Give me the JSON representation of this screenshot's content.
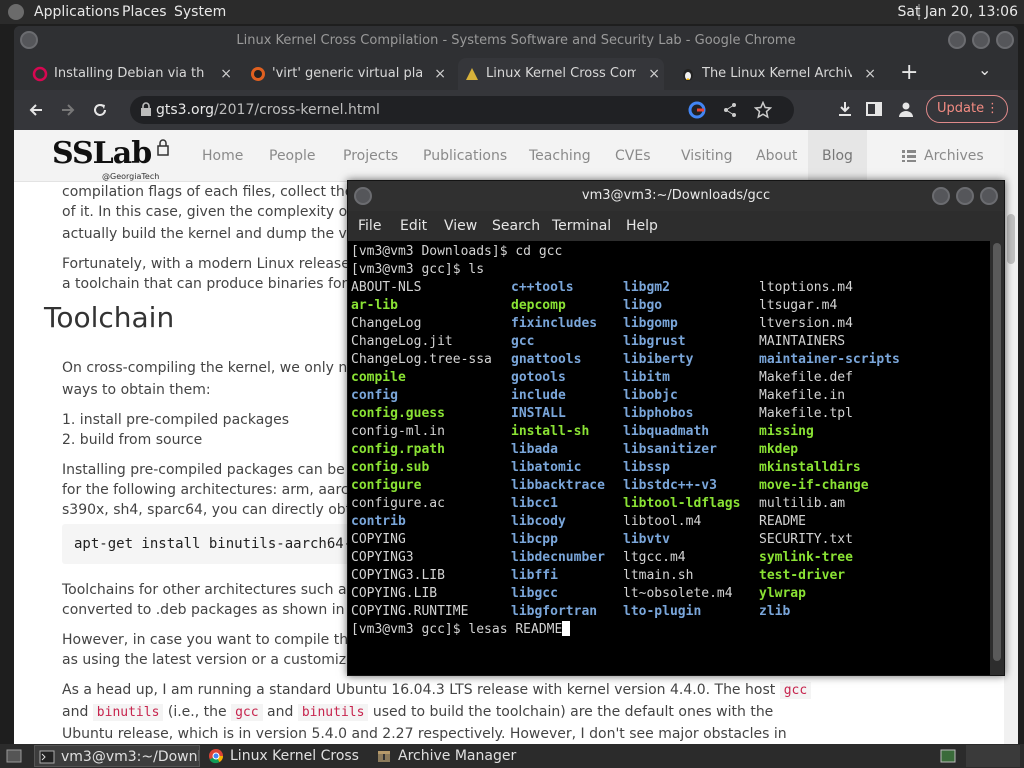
{
  "top_panel": {
    "menus": [
      "Applications",
      "Places",
      "System"
    ],
    "clock": "Sat Jan 20, 13:06"
  },
  "chrome": {
    "window_title": "Linux Kernel Cross Compilation - Systems Software and Security Lab - Google Chrome",
    "tabs": [
      {
        "label": "Installing Debian via the In",
        "close": "×"
      },
      {
        "label": "'virt' generic virtual platfo",
        "close": "×"
      },
      {
        "label": "Linux Kernel Cross Compi",
        "close": "×"
      },
      {
        "label": "The Linux Kernel Archives",
        "close": "×"
      }
    ],
    "new_tab": "+",
    "tab_menu": "⌄",
    "url_domain": "gts3.org",
    "url_path": "/2017/cross-kernel.html",
    "update_label": "Update"
  },
  "site": {
    "logo": "SSLab",
    "logo_sub": "@GeorgiaTech",
    "nav": [
      "Home",
      "People",
      "Projects",
      "Publications",
      "Teaching",
      "CVEs",
      "Visiting",
      "About",
      "Blog",
      "Archives"
    ]
  },
  "article": {
    "p1a": "compilation flags of each files, collect their link",
    "p1b": "of it. In this case, given the complexity of parsi",
    "p1c": "actually build the kernel and dump the verbose",
    "p2a": "Fortunately, with a modern Linux release (like",
    "p2b": "a toolchain that can produce binaries for anoth",
    "heading": "Toolchain",
    "p3a": "On cross-compiling the kernel, we only need t",
    "p3b": "ways to obtain them:",
    "li1": "1. install pre-compiled packages",
    "li2": "2. build from source",
    "p4a": "Installing pre-compiled packages can be a has",
    "p4b": "for the following architectures: arm, aarch64, h",
    "p4c": "s390x, sh4, sparc64, you can directly obtain t",
    "code1": "apt-get install binutils-aarch64-li",
    "p5a": "Toolchains for other architectures such as blac",
    "p5b": "converted to .deb packages as shown in the tu",
    "p6a": "However, in case you want to compile the tool",
    "p6b": "as using the latest version or a customized ve",
    "p7a": "As a head up, I am running a standard Ubuntu 16.04.3 LTS release with kernel version 4.4.0. The host",
    "p7a_code": "gcc",
    "p7b1": "and",
    "p7b_code1": "binutils",
    "p7b2": "(i.e., the",
    "p7b_code2": "gcc",
    "p7b3": "and",
    "p7b_code3": "binutils",
    "p7b4": "used to build the toolchain) are the default ones with the",
    "p7c": "Ubuntu release, which is in version 5.4.0 and 2.27 respectively. However, I don't see major obstacles in"
  },
  "terminal": {
    "title": "vm3@vm3:~/Downloads/gcc",
    "menu": [
      "File",
      "Edit",
      "View",
      "Search",
      "Terminal",
      "Help"
    ],
    "line1": "[vm3@vm3 Downloads]$ cd gcc",
    "line2": "[vm3@vm3 gcc]$ ls",
    "prompt_last": "[vm3@vm3 gcc]$ lesas README",
    "columns": [
      [
        {
          "t": "ABOUT-NLS",
          "c": "plain"
        },
        {
          "t": "ar-lib",
          "c": "exe"
        },
        {
          "t": "ChangeLog",
          "c": "plain"
        },
        {
          "t": "ChangeLog.jit",
          "c": "plain"
        },
        {
          "t": "ChangeLog.tree-ssa",
          "c": "plain"
        },
        {
          "t": "compile",
          "c": "exe"
        },
        {
          "t": "config",
          "c": "dir"
        },
        {
          "t": "config.guess",
          "c": "exe"
        },
        {
          "t": "config-ml.in",
          "c": "plain"
        },
        {
          "t": "config.rpath",
          "c": "exe"
        },
        {
          "t": "config.sub",
          "c": "exe"
        },
        {
          "t": "configure",
          "c": "exe"
        },
        {
          "t": "configure.ac",
          "c": "plain"
        },
        {
          "t": "contrib",
          "c": "dir"
        },
        {
          "t": "COPYING",
          "c": "plain"
        },
        {
          "t": "COPYING3",
          "c": "plain"
        },
        {
          "t": "COPYING3.LIB",
          "c": "plain"
        },
        {
          "t": "COPYING.LIB",
          "c": "plain"
        },
        {
          "t": "COPYING.RUNTIME",
          "c": "plain"
        }
      ],
      [
        {
          "t": "c++tools",
          "c": "dir"
        },
        {
          "t": "depcomp",
          "c": "exe"
        },
        {
          "t": "fixincludes",
          "c": "dir"
        },
        {
          "t": "gcc",
          "c": "dir"
        },
        {
          "t": "gnattools",
          "c": "dir"
        },
        {
          "t": "gotools",
          "c": "dir"
        },
        {
          "t": "include",
          "c": "dir"
        },
        {
          "t": "INSTALL",
          "c": "dir"
        },
        {
          "t": "install-sh",
          "c": "exe"
        },
        {
          "t": "libada",
          "c": "dir"
        },
        {
          "t": "libatomic",
          "c": "dir"
        },
        {
          "t": "libbacktrace",
          "c": "dir"
        },
        {
          "t": "libcc1",
          "c": "dir"
        },
        {
          "t": "libcody",
          "c": "dir"
        },
        {
          "t": "libcpp",
          "c": "dir"
        },
        {
          "t": "libdecnumber",
          "c": "dir"
        },
        {
          "t": "libffi",
          "c": "dir"
        },
        {
          "t": "libgcc",
          "c": "dir"
        },
        {
          "t": "libgfortran",
          "c": "dir"
        }
      ],
      [
        {
          "t": "libgm2",
          "c": "dir"
        },
        {
          "t": "libgo",
          "c": "dir"
        },
        {
          "t": "libgomp",
          "c": "dir"
        },
        {
          "t": "libgrust",
          "c": "dir"
        },
        {
          "t": "libiberty",
          "c": "dir"
        },
        {
          "t": "libitm",
          "c": "dir"
        },
        {
          "t": "libobjc",
          "c": "dir"
        },
        {
          "t": "libphobos",
          "c": "dir"
        },
        {
          "t": "libquadmath",
          "c": "dir"
        },
        {
          "t": "libsanitizer",
          "c": "dir"
        },
        {
          "t": "libssp",
          "c": "dir"
        },
        {
          "t": "libstdc++-v3",
          "c": "dir"
        },
        {
          "t": "libtool-ldflags",
          "c": "exe"
        },
        {
          "t": "libtool.m4",
          "c": "plain"
        },
        {
          "t": "libvtv",
          "c": "dir"
        },
        {
          "t": "ltgcc.m4",
          "c": "plain"
        },
        {
          "t": "ltmain.sh",
          "c": "plain"
        },
        {
          "t": "lt~obsolete.m4",
          "c": "plain"
        },
        {
          "t": "lto-plugin",
          "c": "dir"
        }
      ],
      [
        {
          "t": "ltoptions.m4",
          "c": "plain"
        },
        {
          "t": "ltsugar.m4",
          "c": "plain"
        },
        {
          "t": "ltversion.m4",
          "c": "plain"
        },
        {
          "t": "MAINTAINERS",
          "c": "plain"
        },
        {
          "t": "maintainer-scripts",
          "c": "dir"
        },
        {
          "t": "Makefile.def",
          "c": "plain"
        },
        {
          "t": "Makefile.in",
          "c": "plain"
        },
        {
          "t": "Makefile.tpl",
          "c": "plain"
        },
        {
          "t": "missing",
          "c": "exe"
        },
        {
          "t": "mkdep",
          "c": "exe"
        },
        {
          "t": "mkinstalldirs",
          "c": "exe"
        },
        {
          "t": "move-if-change",
          "c": "exe"
        },
        {
          "t": "multilib.am",
          "c": "plain"
        },
        {
          "t": "README",
          "c": "plain"
        },
        {
          "t": "SECURITY.txt",
          "c": "plain"
        },
        {
          "t": "symlink-tree",
          "c": "exe"
        },
        {
          "t": "test-driver",
          "c": "exe"
        },
        {
          "t": "ylwrap",
          "c": "exe"
        },
        {
          "t": "zlib",
          "c": "dir"
        }
      ]
    ]
  },
  "taskbar": {
    "items": [
      {
        "label": "vm3@vm3:~/Downl..."
      },
      {
        "label": "Linux Kernel Cross ..."
      },
      {
        "label": "Archive Manager"
      }
    ]
  },
  "colors": {
    "dir": "#7aa6da",
    "exe": "#8ae234",
    "update_accent": "#f28b82"
  }
}
